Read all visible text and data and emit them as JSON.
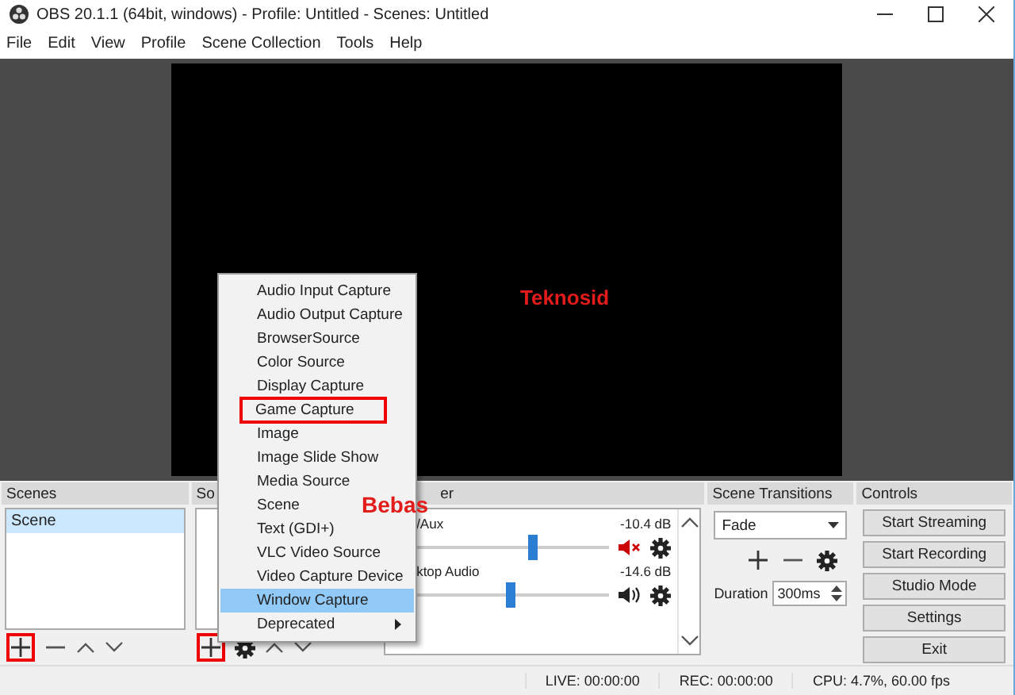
{
  "window": {
    "title": "OBS 20.1.1 (64bit, windows) - Profile: Untitled - Scenes: Untitled"
  },
  "menu": [
    "File",
    "Edit",
    "View",
    "Profile",
    "Scene Collection",
    "Tools",
    "Help"
  ],
  "preview": {
    "annotation": "Teknosid"
  },
  "scenes": {
    "title": "Scenes",
    "add_marked": true,
    "items": [
      {
        "label": "Scene",
        "selected": true
      }
    ]
  },
  "sources": {
    "title": "So",
    "add_marked": true
  },
  "mixer": {
    "title": "er",
    "channels": [
      {
        "name": "/Aux",
        "reading": "-10.4 dB",
        "level": 0.61,
        "muted": true
      },
      {
        "name": "ktop Audio",
        "reading": "-14.6 dB",
        "level": 0.5,
        "muted": false
      }
    ]
  },
  "transitions": {
    "title": "Scene Transitions",
    "transition": "Fade",
    "duration_label": "Duration",
    "duration": "300ms"
  },
  "controls": {
    "title": "Controls",
    "buttons": [
      "Start Streaming",
      "Start Recording",
      "Studio Mode",
      "Settings",
      "Exit"
    ]
  },
  "context_menu": {
    "items": [
      {
        "label": "Audio Input Capture",
        "selected": false,
        "marked": false,
        "submenu": false
      },
      {
        "label": "Audio Output Capture",
        "selected": false,
        "marked": false,
        "submenu": false
      },
      {
        "label": "BrowserSource",
        "selected": false,
        "marked": false,
        "submenu": false
      },
      {
        "label": "Color Source",
        "selected": false,
        "marked": false,
        "submenu": false
      },
      {
        "label": "Display Capture",
        "selected": false,
        "marked": false,
        "submenu": false
      },
      {
        "label": "Game Capture",
        "selected": false,
        "marked": true,
        "submenu": false
      },
      {
        "label": "Image",
        "selected": false,
        "marked": false,
        "submenu": false
      },
      {
        "label": "Image Slide Show",
        "selected": false,
        "marked": false,
        "submenu": false
      },
      {
        "label": "Media Source",
        "selected": false,
        "marked": false,
        "submenu": false
      },
      {
        "label": "Scene",
        "selected": false,
        "marked": false,
        "submenu": false
      },
      {
        "label": "Text (GDI+)",
        "selected": false,
        "marked": false,
        "submenu": false
      },
      {
        "label": "VLC Video Source",
        "selected": false,
        "marked": false,
        "submenu": false
      },
      {
        "label": "Video Capture Device",
        "selected": false,
        "marked": false,
        "submenu": false
      },
      {
        "label": "Window Capture",
        "selected": true,
        "marked": false,
        "submenu": false
      },
      {
        "label": "Deprecated",
        "selected": false,
        "marked": false,
        "submenu": true
      }
    ]
  },
  "annotation": "Bebas",
  "status_bar": {
    "live": "LIVE: 00:00:00",
    "rec": "REC: 00:00:00",
    "cpu": "CPU: 4.7%, 60.00 fps"
  }
}
